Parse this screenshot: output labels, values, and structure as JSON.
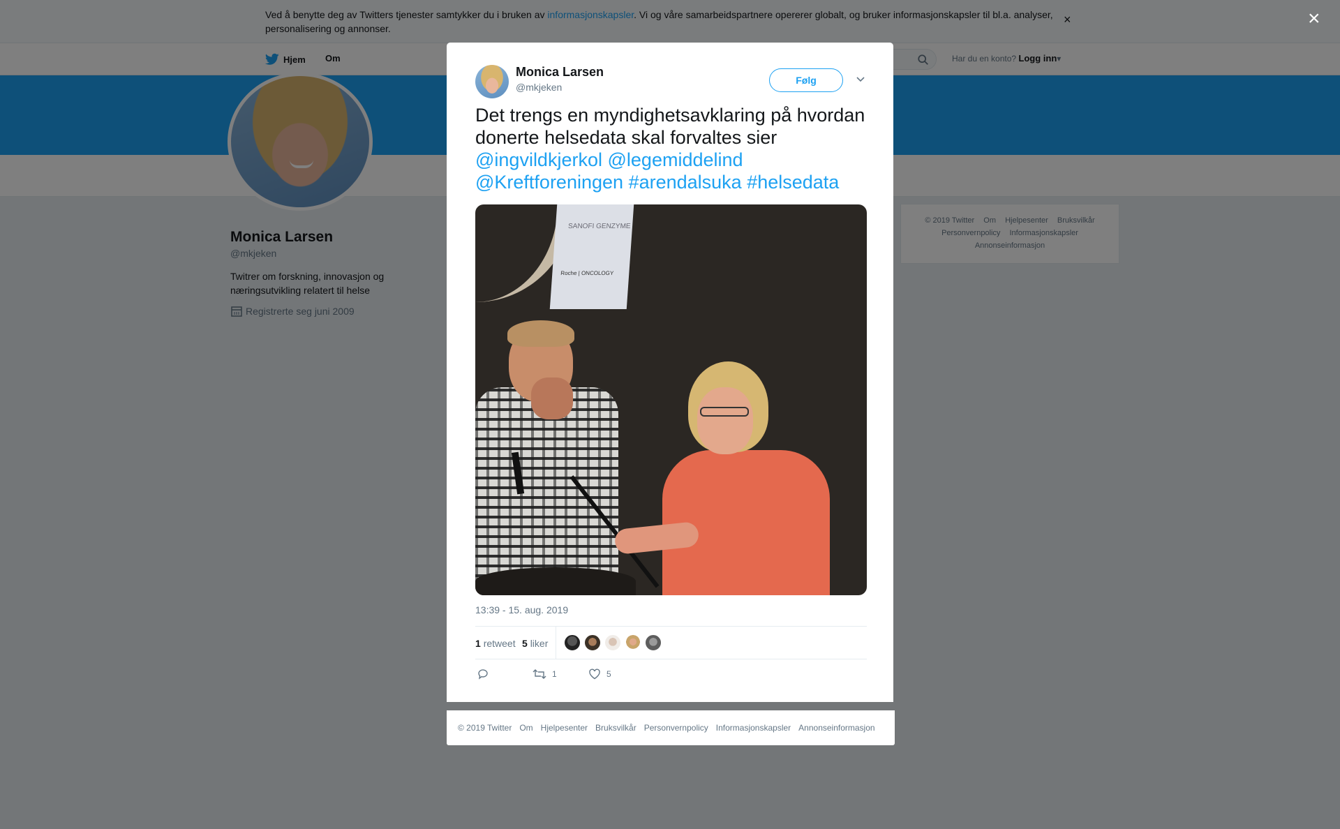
{
  "cookie": {
    "text_before": "Ved å benytte deg av Twitters tjenester samtykker du i bruken av ",
    "link": "informasjonskapsler",
    "text_after": ". Vi og våre samarbeidspartnere opererer globalt, og bruker informasjonskapsler til bl.a. analyser, personalisering og annonser.",
    "close": "×"
  },
  "nav": {
    "home": "Hjem",
    "about": "Om",
    "login_prompt": "Har du en konto?",
    "login": "Logg inn"
  },
  "profile": {
    "name": "Monica Larsen",
    "handle": "@mkjeken",
    "bio": "Twitrer om forskning, innovasjon og næringsutvikling relatert til helse",
    "joined": "Registrerte seg juni 2009"
  },
  "side_footer": {
    "items": [
      "© 2019 Twitter",
      "Om",
      "Hjelpesenter",
      "Bruksvilkår",
      "Personvernpolicy",
      "Informasjonskapsler",
      "Annonseinformasjon"
    ]
  },
  "overlay": {
    "close": "×"
  },
  "tweet": {
    "name": "Monica Larsen",
    "handle": "@mkjeken",
    "follow": "Følg",
    "text_plain": "Det trengs en myndighetsavklaring på hvordan donerte helsedata skal forvaltes sier",
    "mentions": [
      "@ingvildkjerkol",
      "@legemiddelind",
      "@Kreftforeningen",
      "#arendalsuka",
      "#helsedata"
    ],
    "image_logo_1": "SANOFI GENZYME",
    "image_logo_2": "Roche | ONCOLOGY",
    "timestamp": "13:39 - 15. aug. 2019",
    "retweets_count": "1",
    "retweets_label": "retweet",
    "likes_count": "5",
    "likes_label": "liker",
    "reply_count": "",
    "retweet_action_count": "1",
    "like_action_count": "5"
  },
  "modal_footer": {
    "items": [
      "© 2019 Twitter",
      "Om",
      "Hjelpesenter",
      "Bruksvilkår",
      "Personvernpolicy",
      "Informasjonskapsler",
      "Annonseinformasjon"
    ]
  },
  "colors": {
    "accent": "#1da1f2",
    "overlay": "rgba(0,0,0,0.5)"
  }
}
